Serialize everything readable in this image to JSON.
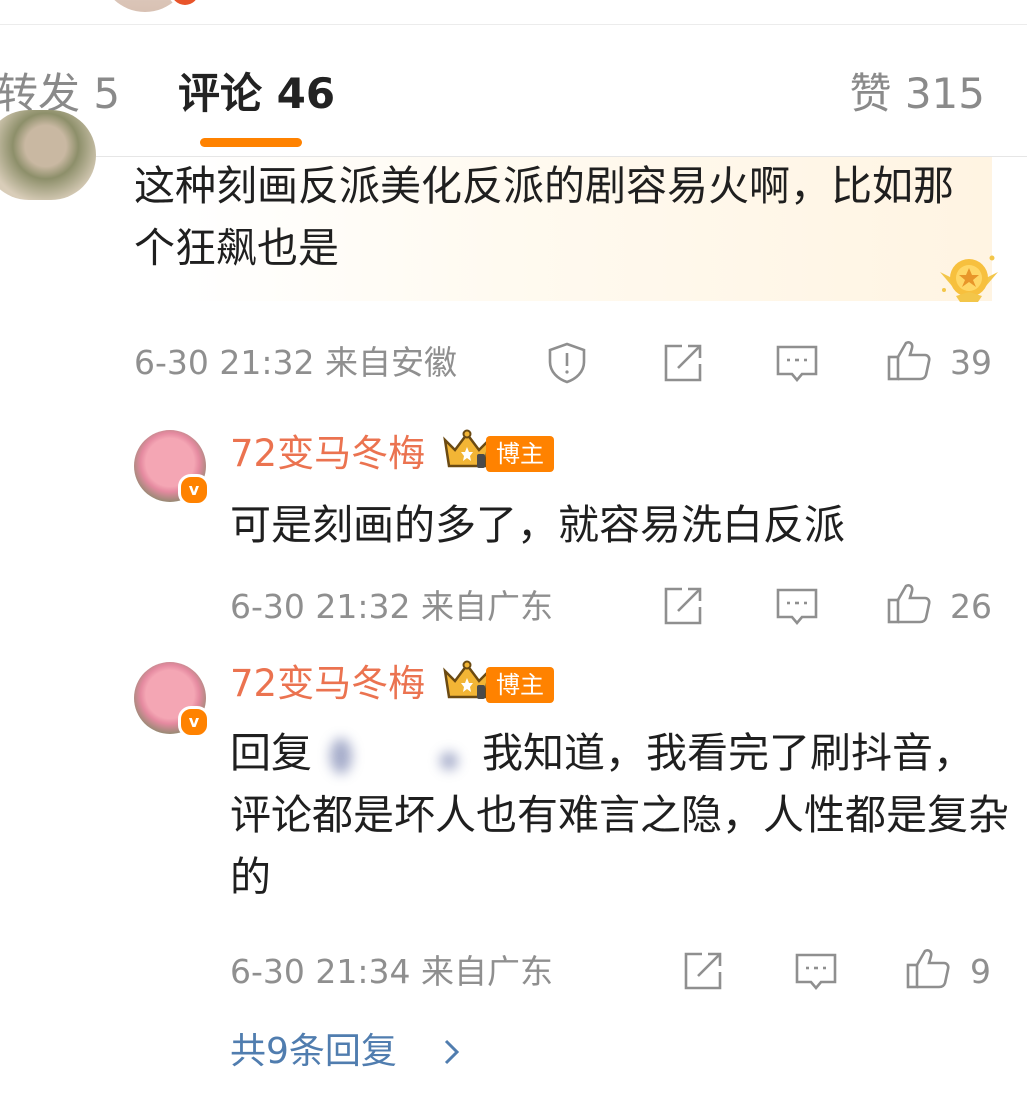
{
  "tabs": {
    "repost": "转发 5",
    "comment": "评论 46",
    "like": "赞 315"
  },
  "comment": {
    "text": "这种刻画反派美化反派的剧容易火啊，比如那个狂飙也是",
    "meta": "6-30 21:32  来自安徽",
    "like_count": "39"
  },
  "replies": [
    {
      "author": "72变马冬梅",
      "tag": "博主",
      "verified_badge": "v",
      "text": "可是刻画的多了，就容易洗白反派",
      "meta": "6-30 21:32  来自广东",
      "like_count": "26"
    },
    {
      "author": "72变马冬梅",
      "tag": "博主",
      "verified_badge": "v",
      "text_prefix": "回复",
      "text_after": "我知道，我看完了刷抖音，评论都是坏人也有难言之隐，人性都是复杂的",
      "meta": "6-30 21:34  来自广东",
      "like_count": "9"
    }
  ],
  "more_replies": "共9条回复",
  "colors": {
    "accent": "#ff8200",
    "author": "#eb7350",
    "link": "#507daf",
    "meta": "#8f8f8f"
  },
  "icons": [
    "report-icon",
    "share-icon",
    "reply-icon",
    "like-icon",
    "crown-icon",
    "medal-icon",
    "chevron-right-icon"
  ]
}
